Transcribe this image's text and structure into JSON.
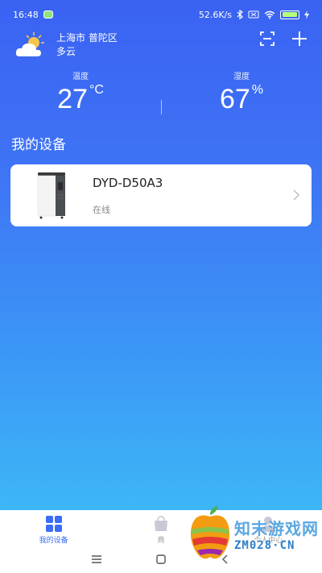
{
  "status_bar": {
    "time": "16:48",
    "net_speed": "52.6K/s",
    "battery": "100"
  },
  "weather": {
    "location": "上海市 普陀区",
    "condition": "多云",
    "icon": "partly-cloudy-icon"
  },
  "metrics": {
    "temperature": {
      "label": "温度",
      "value": "27",
      "unit": "°C"
    },
    "humidity": {
      "label": "湿度",
      "value": "67",
      "unit": "%"
    }
  },
  "section_title": "我的设备",
  "devices": [
    {
      "name": "DYD-D50A3",
      "status": "在线"
    }
  ],
  "tabs": [
    {
      "label": "我的设备",
      "active": true
    },
    {
      "label": "商",
      "active": false
    },
    {
      "label": "个人中心",
      "active": false
    }
  ],
  "watermark": {
    "cn": "知末游戏网",
    "en": "ZM028·CN"
  },
  "colors": {
    "accent": "#3b6cf5",
    "gradient_top": "#3a62f3",
    "gradient_bottom": "#3ec3f6"
  }
}
